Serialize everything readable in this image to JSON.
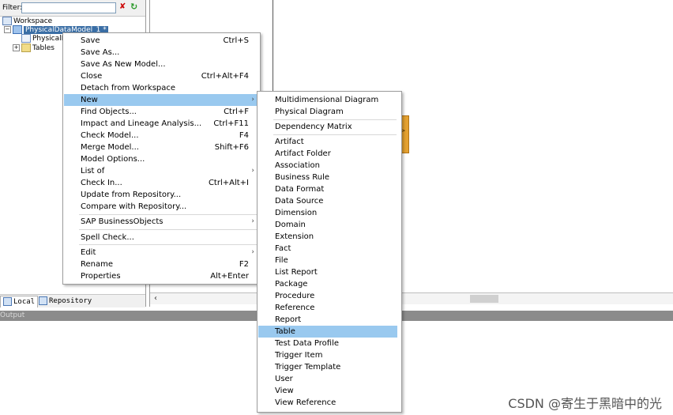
{
  "workspace": {
    "filter_label": "Filter:",
    "filter_value": "",
    "tree": {
      "root": "Workspace",
      "model": "PhysicalDataModel_1 *",
      "diagram": "PhysicalD",
      "tables": "Tables"
    },
    "tabs": {
      "local": "Local",
      "repository": "Repository"
    }
  },
  "diagram": {
    "entity_arrow": ">"
  },
  "output": {
    "title": "Output"
  },
  "context_menu": {
    "items": [
      {
        "label": "Save",
        "accelerator": "Ctrl+S"
      },
      {
        "label": "Save As...",
        "accelerator": ""
      },
      {
        "label": "Save As New Model...",
        "accelerator": ""
      },
      {
        "label": "Close",
        "accelerator": "Ctrl+Alt+F4"
      },
      {
        "label": "Detach from Workspace",
        "accelerator": ""
      },
      {
        "label": "New",
        "accelerator": "",
        "submenu": true,
        "highlighted": true
      },
      {
        "label": "Find Objects...",
        "accelerator": "Ctrl+F"
      },
      {
        "label": "Impact and Lineage Analysis...",
        "accelerator": "Ctrl+F11"
      },
      {
        "label": "Check Model...",
        "accelerator": "F4"
      },
      {
        "label": "Merge Model...",
        "accelerator": "Shift+F6"
      },
      {
        "label": "Model Options...",
        "accelerator": ""
      },
      {
        "label": "List of",
        "accelerator": "",
        "submenu": true
      },
      {
        "label": "Check In...",
        "accelerator": "Ctrl+Alt+I"
      },
      {
        "label": "Update from Repository...",
        "accelerator": ""
      },
      {
        "label": "Compare with Repository...",
        "accelerator": ""
      },
      {
        "label": "SAP BusinessObjects",
        "accelerator": "",
        "submenu": true
      },
      {
        "label": "Spell Check...",
        "accelerator": ""
      },
      {
        "label": "Edit",
        "accelerator": "",
        "submenu": true
      },
      {
        "label": "Rename",
        "accelerator": "F2"
      },
      {
        "label": "Properties",
        "accelerator": "Alt+Enter"
      }
    ]
  },
  "new_submenu": {
    "items": [
      "Multidimensional Diagram",
      "Physical Diagram",
      "Dependency Matrix",
      "Artifact",
      "Artifact Folder",
      "Association",
      "Business Rule",
      "Data Format",
      "Data Source",
      "Dimension",
      "Domain",
      "Extension",
      "Fact",
      "File",
      "List Report",
      "Package",
      "Procedure",
      "Reference",
      "Report",
      "Table",
      "Test Data Profile",
      "Trigger Item",
      "Trigger Template",
      "User",
      "View",
      "View Reference"
    ],
    "highlighted": "Table"
  },
  "watermark": "CSDN @寄生于黑暗中的光",
  "colors": {
    "highlight": "#99c9ef",
    "selection": "#3a6ea5",
    "entity": "#e4a130"
  }
}
